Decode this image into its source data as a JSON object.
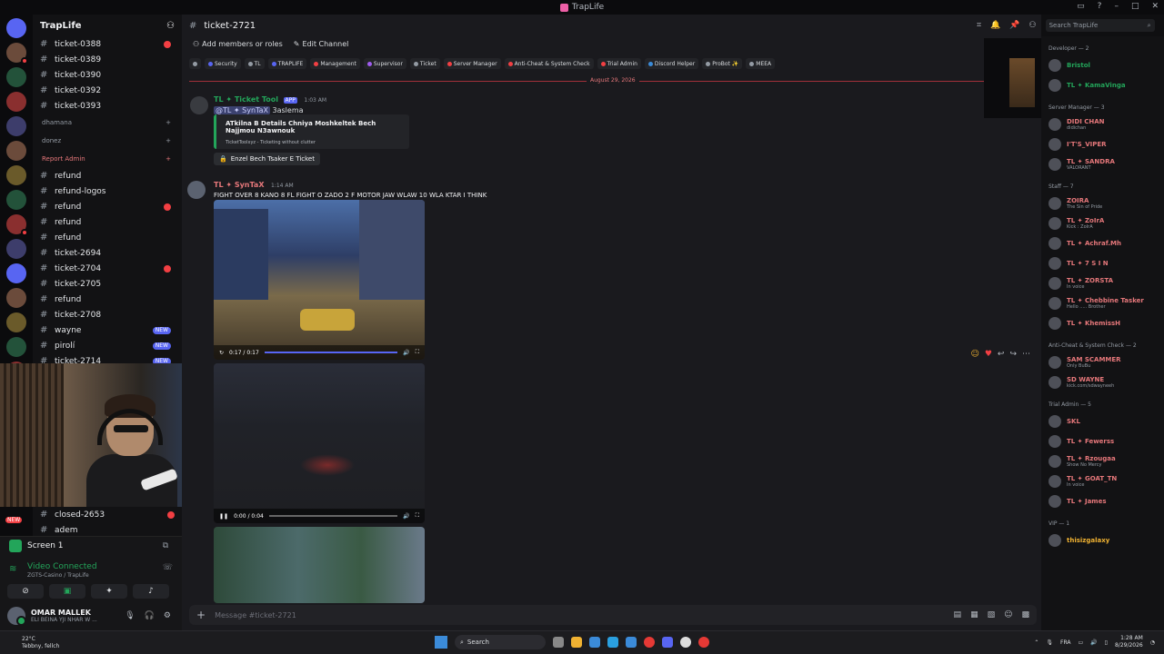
{
  "window": {
    "title": "TrapLife"
  },
  "guild": {
    "name": "TrapLife"
  },
  "channels": [
    {
      "name": "ticket-0388",
      "badge": "dot"
    },
    {
      "name": "ticket-0389"
    },
    {
      "name": "ticket-0390"
    },
    {
      "name": "ticket-0392"
    },
    {
      "name": "ticket-0393"
    }
  ],
  "categories": {
    "dhamana": "dhamana",
    "donez": "donez",
    "report_admin": "Report Admin"
  },
  "channels2": [
    {
      "name": "refund"
    },
    {
      "name": "refund-logos"
    },
    {
      "name": "refund",
      "badge": "dot"
    },
    {
      "name": "refund"
    },
    {
      "name": "refund"
    },
    {
      "name": "ticket-2694"
    },
    {
      "name": "ticket-2704",
      "badge": "dot"
    },
    {
      "name": "ticket-2705"
    },
    {
      "name": "refund"
    },
    {
      "name": "ticket-2708"
    },
    {
      "name": "wayne",
      "badge": "new"
    },
    {
      "name": "pirolí",
      "badge": "new"
    },
    {
      "name": "ticket-2714",
      "badge": "new"
    }
  ],
  "channels3": [
    {
      "name": "closed-2653",
      "badge": "dot"
    },
    {
      "name": "adem"
    }
  ],
  "badges": {
    "new": "NEW",
    "new_rail": "NEW"
  },
  "voice": {
    "screen_label": "Screen 1",
    "connected": "Video Connected",
    "server": "ZGTS-Casino / TrapLife"
  },
  "user": {
    "name": "OMAR MALLEK",
    "status": "ELI BEINA YJI NHAR W ..."
  },
  "header": {
    "channel": "ticket-2721",
    "add_members": "Add members or roles",
    "edit_channel": "Edit Channel",
    "search_placeholder": "Search TrapLife"
  },
  "tags": [
    {
      "label": "",
      "color": "#949ba4"
    },
    {
      "label": "Security",
      "color": "#5865f2"
    },
    {
      "label": "TL",
      "color": "#949ba4"
    },
    {
      "label": "TRAPLIFE",
      "color": "#5865f2"
    },
    {
      "label": "Management",
      "color": "#f23f43"
    },
    {
      "label": "Supervisor",
      "color": "#a05cf0"
    },
    {
      "label": "Ticket",
      "color": "#949ba4"
    },
    {
      "label": "Server Manager",
      "color": "#f23f43"
    },
    {
      "label": "Anti-Cheat & System Check",
      "color": "#f23f43"
    },
    {
      "label": "Trial Admin",
      "color": "#f23f43"
    },
    {
      "label": "Discord Helper",
      "color": "#3b8bd9"
    },
    {
      "label": "ProBot ✨",
      "color": "#949ba4"
    },
    {
      "label": "MEEA",
      "color": "#949ba4"
    }
  ],
  "date_divider": "August 29, 2026",
  "msg1": {
    "author": "TL ✦ Ticket Tool",
    "app": "APP",
    "time": "1:03 AM",
    "mention": "@TL ✦ SynTaX",
    "text": "3aslema",
    "embed_title": "ATkilna B Details Chniya Moshkeltek Bech Najjmou N3awnouk",
    "embed_footer": "TicketToolxyz - Ticketing without clutter",
    "button": "Enzel Bech Tsaker E Ticket"
  },
  "msg2": {
    "author": "TL ✦ SynTaX",
    "time": "1:14 AM",
    "text": "FIGHT OVER 8 KANO 8 FL FIGHT O ZADO 2 F MOTOR JAW WLAW 10 WLA KTAR I THINK"
  },
  "video1": {
    "time": "0:17 / 0:17",
    "progress": 1.0
  },
  "video2": {
    "time": "0:00 / 0:04",
    "progress": 0.0
  },
  "composer": {
    "placeholder": "Message #ticket-2721"
  },
  "member_groups": [
    {
      "title": "Developer — 2",
      "members": [
        {
          "name": "Bristol",
          "color": "green"
        },
        {
          "name": "TL ✦ KamaVinga",
          "color": "green"
        }
      ]
    },
    {
      "title": "Server Manager — 3",
      "members": [
        {
          "name": "DIDI CHAN",
          "sub": "didichan"
        },
        {
          "name": "I'T'S_VIPER"
        },
        {
          "name": "TL ✦ SANDRA",
          "sub": "VALORANT"
        }
      ]
    },
    {
      "title": "Staff — 7",
      "members": [
        {
          "name": "ZOIRA",
          "sub": "The Sin of Pride"
        },
        {
          "name": "TL ✦ ZoIrA",
          "sub": "Kick : ZoIrA"
        },
        {
          "name": "TL ✦ Achraf.Mh"
        },
        {
          "name": "TL ✦ 7 S I N"
        },
        {
          "name": "TL ✦ ZORSTA",
          "sub": "In voice"
        },
        {
          "name": "TL ✦ Chebbine Tasker",
          "sub": "Hello ..... Brother"
        },
        {
          "name": "TL ✦ KhemissH"
        }
      ]
    },
    {
      "title": "Anti-Cheat & System Check — 2",
      "members": [
        {
          "name": "SAM SCAMMER",
          "sub": "Only BuBu"
        },
        {
          "name": "SD WAYNE",
          "sub": "kick.com/sdwayneeh"
        }
      ]
    },
    {
      "title": "Trial Admin — 5",
      "members": [
        {
          "name": "SKL"
        },
        {
          "name": "TL ✦ Fewerss"
        },
        {
          "name": "TL ✦ Rzougaa",
          "sub": "Show No Mercy"
        },
        {
          "name": "TL ✦ GOAT_TN",
          "sub": "In voice"
        },
        {
          "name": "TL ✦ James"
        }
      ]
    },
    {
      "title": "VIP — 1",
      "members": [
        {
          "name": "thisizgalaxy",
          "color": "yellow"
        }
      ]
    }
  ],
  "taskbar": {
    "weather_temp": "22°C",
    "weather_desc": "Tebbny, fellch",
    "search": "Search",
    "lang": "FRA",
    "time": "1:28 AM",
    "date": "8/29/2026"
  }
}
